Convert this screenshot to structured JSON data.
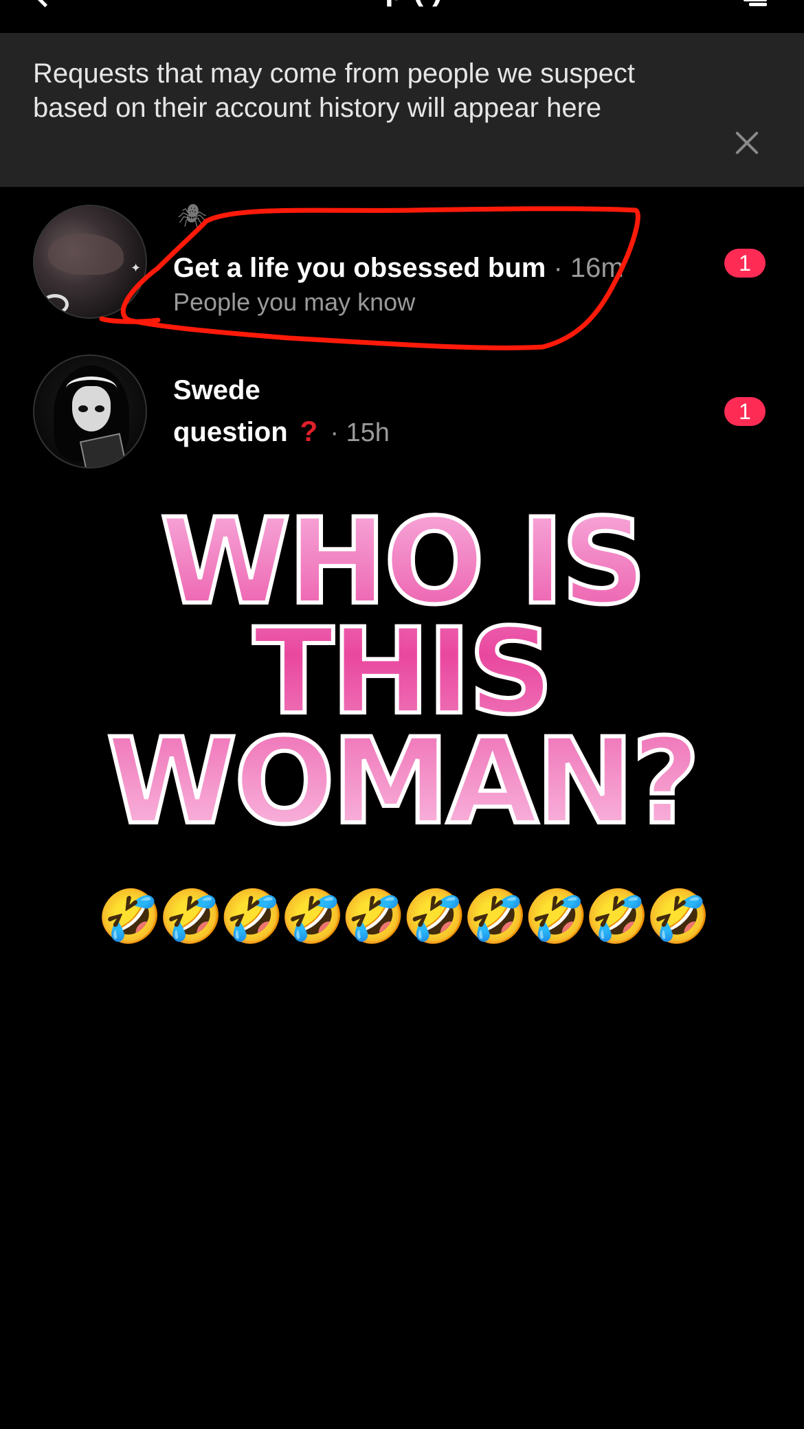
{
  "header": {
    "title_fragment": "p  (  )"
  },
  "banner": {
    "text": "Requests that may come from people we suspect based on their account history will appear here"
  },
  "requests": [
    {
      "title": "Get a life you obsessed bum",
      "time": " · 16m",
      "subtitle": "People you may know",
      "badge": "1"
    },
    {
      "title": "Swede",
      "message": "question",
      "time": "· 15h",
      "badge": "1"
    }
  ],
  "overlay": {
    "line1": "WHO IS",
    "line2": "THIS",
    "line3": "WOMAN?",
    "emojis": "🤣🤣🤣🤣🤣🤣🤣🤣🤣🤣"
  },
  "colors": {
    "background": "#000000",
    "banner": "#242424",
    "badge": "#fe2c55",
    "annotation": "#ff1a0a",
    "meme_pink": "#e9489f"
  },
  "icons": {
    "back": "chevron-left-icon",
    "filter": "filter-icon",
    "close": "close-icon",
    "spider": "spider-icon",
    "question": "red-question-mark-icon"
  }
}
